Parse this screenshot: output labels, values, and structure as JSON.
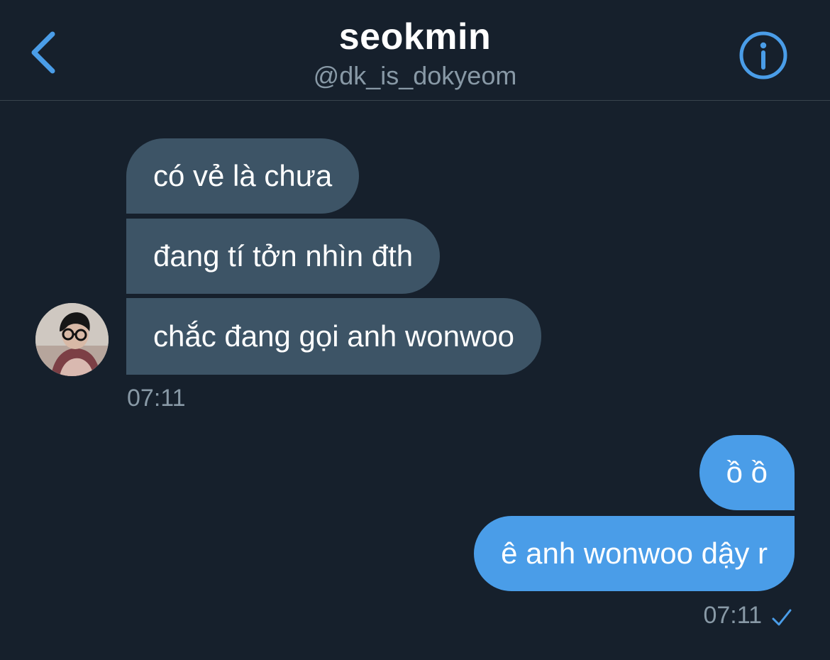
{
  "header": {
    "title": "seokmin",
    "handle": "@dk_is_dokyeom",
    "back_icon": "chevron-left-icon",
    "info_icon": "info-circle-icon",
    "accent_color": "#4a9de8"
  },
  "conversation": {
    "incoming": [
      {
        "text": "có vẻ là chưa"
      },
      {
        "text": "đang tí tởn nhìn đth"
      },
      {
        "text": "chắc đang gọi anh wonwoo"
      }
    ],
    "incoming_time": "07:11",
    "outgoing": [
      {
        "text": "ồ ồ"
      },
      {
        "text": "ê anh wonwoo dậy r"
      }
    ],
    "outgoing_time": "07:11",
    "read_icon": "checkmark-icon"
  },
  "colors": {
    "background": "#16202c",
    "incoming_bubble": "#3d5466",
    "outgoing_bubble": "#4a9de8",
    "secondary_text": "#8899a6"
  }
}
